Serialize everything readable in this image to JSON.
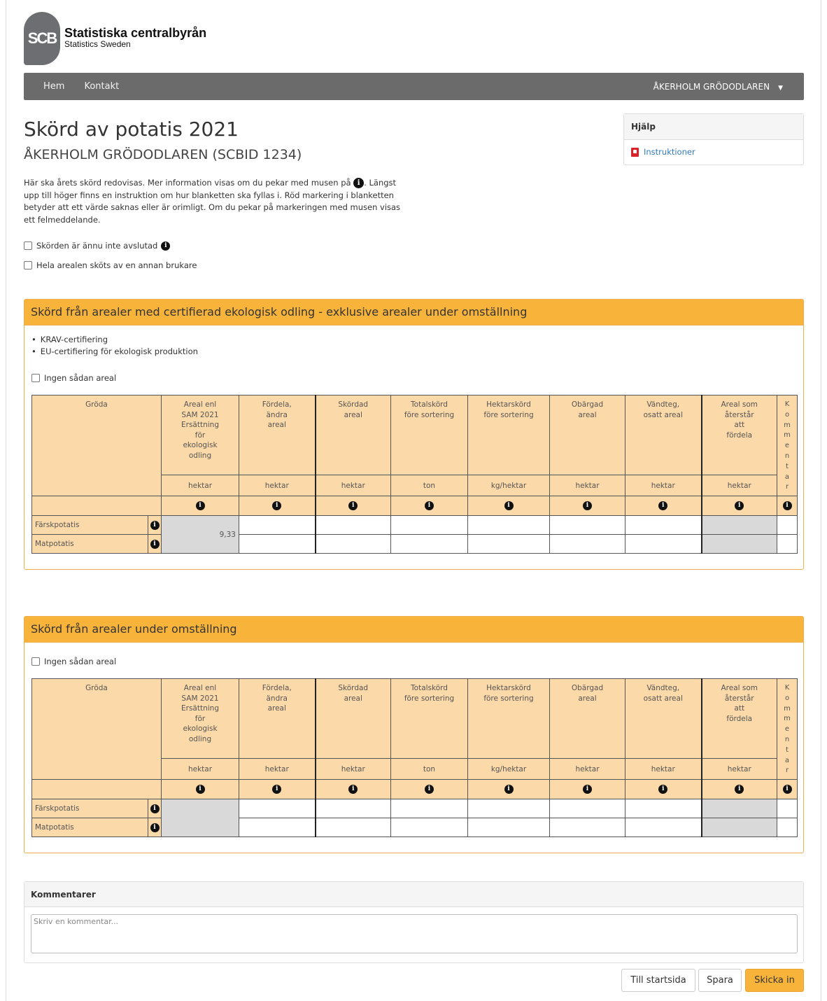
{
  "logo": {
    "mark": "SCB",
    "title": "Statistiska centralbyrån",
    "subtitle": "Statistics Sweden"
  },
  "nav": {
    "items": [
      "Hem",
      "Kontakt"
    ],
    "user": "ÅKERHOLM GRÖDODLAREN"
  },
  "page": {
    "title": "Skörd av potatis 2021",
    "subtitle": "ÅKERHOLM GRÖDODLAREN (SCBID 1234)",
    "intro_part1": "Här ska årets skörd redovisas. Mer information visas om du pekar med musen på",
    "intro_part2": ". Längst upp till höger finns en instruktion om hur blanketten ska fyllas i. Röd markering i blanketten betyder att ett värde saknas eller är orimligt. Om du pekar på markeringen med musen visas ett felmeddelande.",
    "check_not_finished": "Skörden är ännu inte avslutad",
    "check_other_farmer": "Hela arealen sköts av en annan brukare"
  },
  "help": {
    "title": "Hjälp",
    "link": "Instruktioner"
  },
  "section1": {
    "title": "Skörd från arealer med certifierad ekologisk odling - exklusive arealer under omställning",
    "bullets": [
      "KRAV-certifiering",
      "EU-certifiering för ekologisk produktion"
    ],
    "no_area": "Ingen sådan areal",
    "sam_value": "9,33"
  },
  "section2": {
    "title": "Skörd från arealer under omställning",
    "no_area": "Ingen sådan areal"
  },
  "table": {
    "crop_header": "Gröda",
    "comment_header": "Kommentar",
    "columns": [
      {
        "l1": "Areal enl",
        "l2": "SAM 2021",
        "l3": "Ersättning",
        "l4": "för",
        "l5": "ekologisk",
        "l6": "odling",
        "unit": "hektar"
      },
      {
        "l1": "Fördela,",
        "l2": "ändra",
        "l3": "areal",
        "l4": "",
        "l5": "",
        "l6": "",
        "unit": "hektar"
      },
      {
        "l1": "Skördad",
        "l2": "areal",
        "l3": "",
        "l4": "",
        "l5": "",
        "l6": "",
        "unit": "hektar"
      },
      {
        "l1": "Totalskörd",
        "l2": "före sortering",
        "l3": "",
        "l4": "",
        "l5": "",
        "l6": "",
        "unit": "ton"
      },
      {
        "l1": "Hektarskörd",
        "l2": "före sortering",
        "l3": "",
        "l4": "",
        "l5": "",
        "l6": "",
        "unit": "kg/hektar"
      },
      {
        "l1": "Obärgad",
        "l2": "areal",
        "l3": "",
        "l4": "",
        "l5": "",
        "l6": "",
        "unit": "hektar"
      },
      {
        "l1": "Vändteg,",
        "l2": "osatt areal",
        "l3": "",
        "l4": "",
        "l5": "",
        "l6": "",
        "unit": "hektar"
      },
      {
        "l1": "Areal som",
        "l2": "återstår",
        "l3": "att",
        "l4": "fördela",
        "l5": "",
        "l6": "",
        "unit": "hektar"
      }
    ],
    "rows": [
      "Färskpotatis",
      "Matpotatis"
    ]
  },
  "comments": {
    "title": "Kommentarer",
    "placeholder": "Skriv en kommentar..."
  },
  "buttons": {
    "home": "Till startsida",
    "save": "Spara",
    "submit": "Skicka in"
  }
}
